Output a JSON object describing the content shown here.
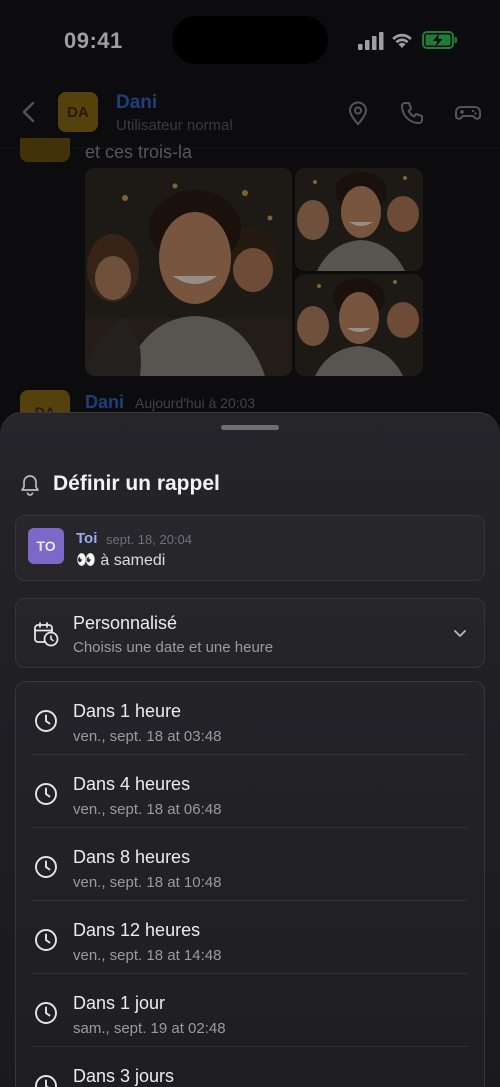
{
  "status_bar": {
    "time": "09:41"
  },
  "chat": {
    "contact_name": "Dani",
    "contact_initials": "DA",
    "contact_status": "Utilisateur normal",
    "partial_message": "et ces trois-la",
    "next_message_author": "Dani",
    "next_message_initials": "DA",
    "next_message_time": "Aujourd'hui à 20:03"
  },
  "sheet": {
    "title": "Définir un rappel",
    "message": {
      "author": "Toi",
      "initials": "TO",
      "time": "sept. 18, 20:04",
      "text": "👀 à samedi"
    },
    "custom": {
      "title": "Personnalisé",
      "subtitle": "Choisis une date et une heure"
    },
    "options": [
      {
        "title": "Dans 1 heure",
        "subtitle": "ven., sept. 18 at 03:48"
      },
      {
        "title": "Dans 4 heures",
        "subtitle": "ven., sept. 18 at 06:48"
      },
      {
        "title": "Dans 8 heures",
        "subtitle": "ven., sept. 18 at 10:48"
      },
      {
        "title": "Dans 12 heures",
        "subtitle": "ven., sept. 18 at 14:48"
      },
      {
        "title": "Dans 1 jour",
        "subtitle": "sam., sept. 19 at 02:48"
      },
      {
        "title": "Dans 3 jours",
        "subtitle": ""
      }
    ]
  },
  "colors": {
    "accent_blue": "#2f67c8",
    "avatar_gold": "#8a6a14",
    "avatar_purple": "#7b68c8",
    "battery_green": "#34c759"
  }
}
